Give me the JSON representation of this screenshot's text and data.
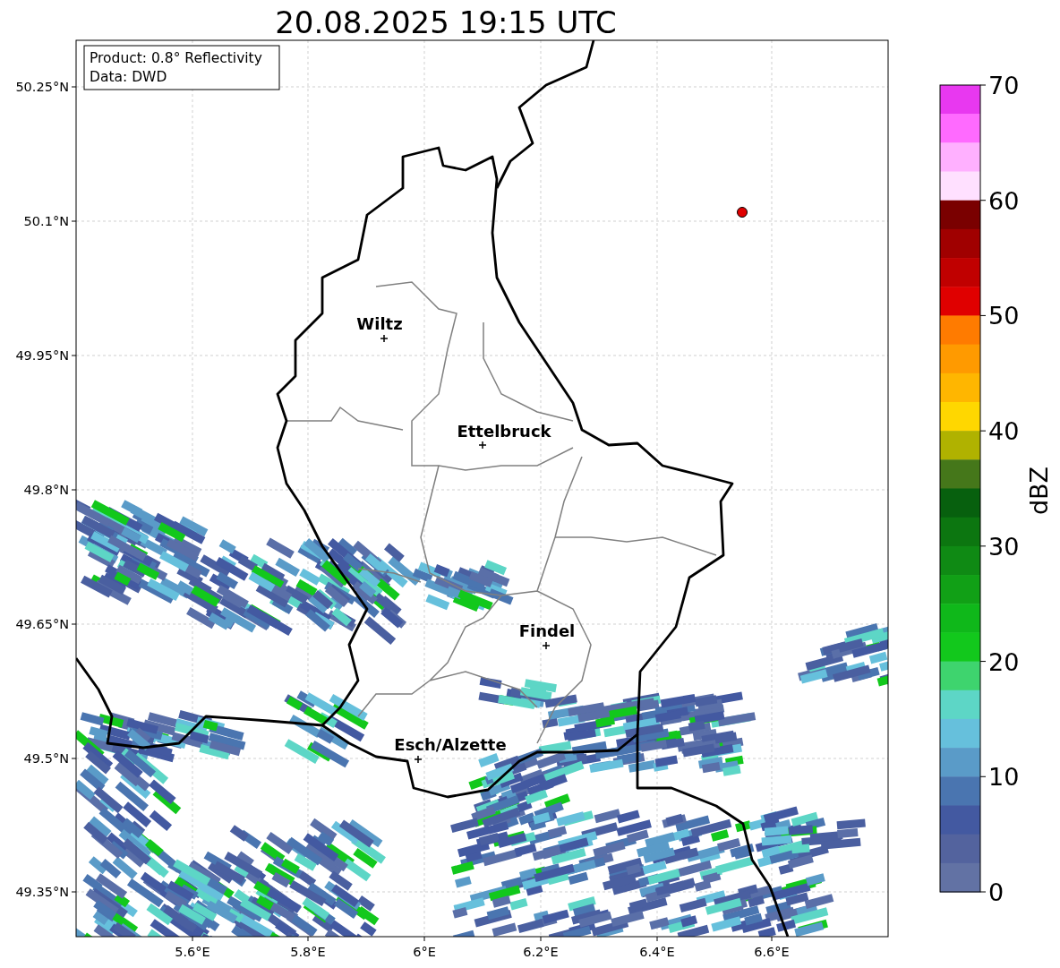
{
  "title": "20.08.2025 19:15 UTC",
  "info_box": [
    "Product: 0.8° Reflectivity",
    "Data: DWD"
  ],
  "lat_ticks": [
    "50.25°N",
    "50.1°N",
    "49.95°N",
    "49.8°N",
    "49.65°N",
    "49.5°N",
    "49.35°N"
  ],
  "lon_ticks": [
    "5.6°E",
    "5.8°E",
    "6°E",
    "6.2°E",
    "6.4°E",
    "6.6°E"
  ],
  "cities": [
    {
      "name": "Wiltz"
    },
    {
      "name": "Ettelbruck"
    },
    {
      "name": "Findel"
    },
    {
      "name": "Esch/Alzette"
    }
  ],
  "colorbar": {
    "label": "dBZ",
    "ticks": [
      "70",
      "60",
      "50",
      "40",
      "30",
      "20",
      "10",
      "0"
    ],
    "segments": [
      {
        "color": "#e838f0"
      },
      {
        "color": "#ff6aff"
      },
      {
        "color": "#ffb0ff"
      },
      {
        "color": "#ffe0ff"
      },
      {
        "color": "#7a0000"
      },
      {
        "color": "#a00000"
      },
      {
        "color": "#c00000"
      },
      {
        "color": "#e00000"
      },
      {
        "color": "#ff7b00"
      },
      {
        "color": "#ff9a00"
      },
      {
        "color": "#ffb600"
      },
      {
        "color": "#ffd700"
      },
      {
        "color": "#b0b200"
      },
      {
        "color": "#45771a"
      },
      {
        "color": "#07600e"
      },
      {
        "color": "#0c7610"
      },
      {
        "color": "#0f8a14"
      },
      {
        "color": "#11a016"
      },
      {
        "color": "#0fb81a"
      },
      {
        "color": "#12c81c"
      },
      {
        "color": "#3ed46e"
      },
      {
        "color": "#5dd6c6"
      },
      {
        "color": "#66c0dc"
      },
      {
        "color": "#5a9bc8"
      },
      {
        "color": "#4a75b0"
      },
      {
        "color": "#4359a1"
      },
      {
        "color": "#53639e"
      },
      {
        "color": "#6272a4"
      }
    ]
  }
}
